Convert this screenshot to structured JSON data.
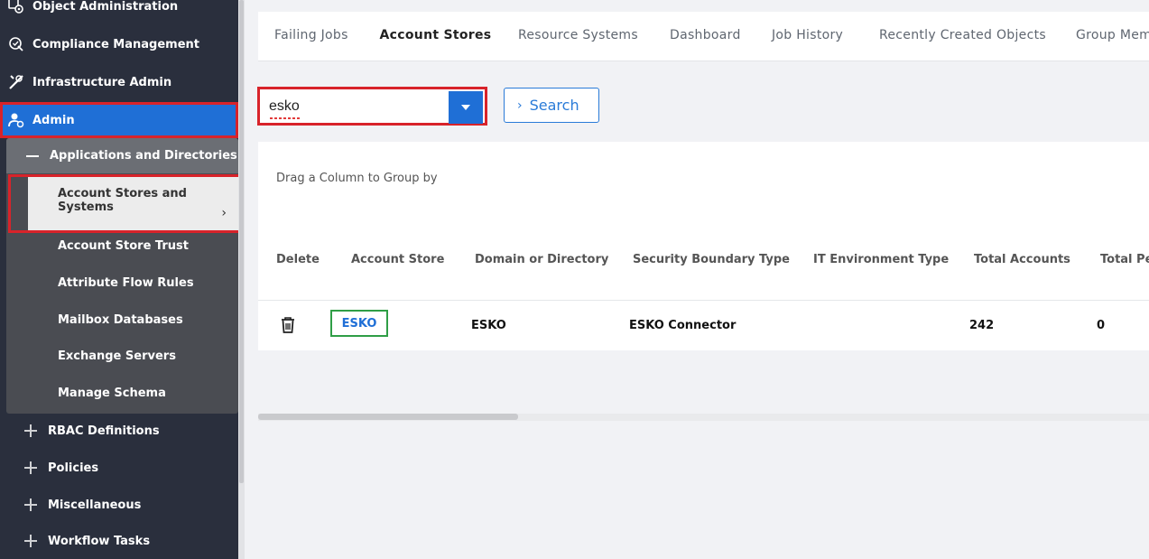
{
  "sidebar": {
    "items": [
      {
        "label": "Object Administration",
        "icon": "object-gear-icon"
      },
      {
        "label": "Compliance Management",
        "icon": "compliance-shield-icon"
      },
      {
        "label": "Infrastructure Admin",
        "icon": "tools-icon"
      },
      {
        "label": "Admin",
        "icon": "user-gear-icon"
      }
    ],
    "submenu": {
      "title": "Applications and Directories",
      "active": "Account Stores and Systems",
      "items": [
        "Account Store Trust",
        "Attribute Flow Rules",
        "Mailbox Databases",
        "Exchange Servers",
        "Manage Schema"
      ]
    },
    "collapsed": [
      "RBAC Definitions",
      "Policies",
      "Miscellaneous",
      "Workflow Tasks"
    ]
  },
  "tabs": [
    "Failing Jobs",
    "Account Stores",
    "Resource Systems",
    "Dashboard",
    "Job History",
    "Recently Created Objects",
    "Group Mem"
  ],
  "active_tab": "Account Stores",
  "search": {
    "value": "esko",
    "button_label": "Search"
  },
  "grid": {
    "group_hint": "Drag a Column to Group by",
    "columns": [
      "Delete",
      "Account Store",
      "Domain or Directory",
      "Security Boundary Type",
      "IT Environment Type",
      "Total Accounts",
      "Total Pe"
    ],
    "row": {
      "account_store": "ESKO",
      "domain": "ESKO",
      "security_boundary": "ESKO Connector",
      "it_env": "",
      "total_accounts": "242",
      "total_pe": "0"
    }
  },
  "colors": {
    "accent": "#1f6fd6",
    "highlight_red": "#d8232a",
    "highlight_green": "#2f9e46",
    "sidebar_bg": "#2a2f3d"
  }
}
